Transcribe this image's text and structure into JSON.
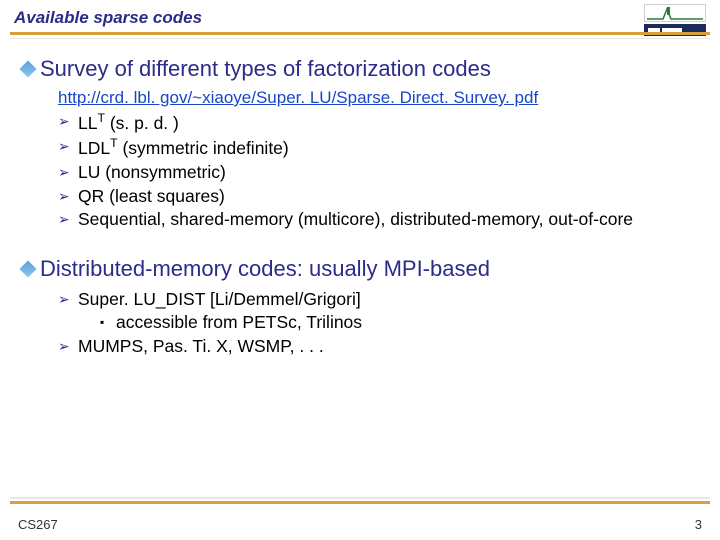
{
  "header": {
    "title": "Available sparse codes"
  },
  "section1": {
    "heading": "Survey of different types of factorization codes",
    "link": "http://crd. lbl. gov/~xiaoye/Super. LU/Sparse. Direct. Survey. pdf",
    "items": {
      "i0_pre": "LL",
      "i0_post": " (s. p. d. )",
      "i1_pre": "LDL",
      "i1_post": " (symmetric indefinite)",
      "i2": "LU (nonsymmetric)",
      "i3": "QR (least squares)",
      "i4": "Sequential, shared-memory (multicore), distributed-memory, out-of-core"
    }
  },
  "section2": {
    "heading": "Distributed-memory codes: usually MPI-based",
    "items": {
      "i0": "Super. LU_DIST [Li/Demmel/Grigori]",
      "i0sub": "accessible from PETSc, Trilinos",
      "i1": "MUMPS, Pas. Ti. X, WSMP, . . ."
    }
  },
  "footer": {
    "left": "CS267",
    "right": "3"
  }
}
